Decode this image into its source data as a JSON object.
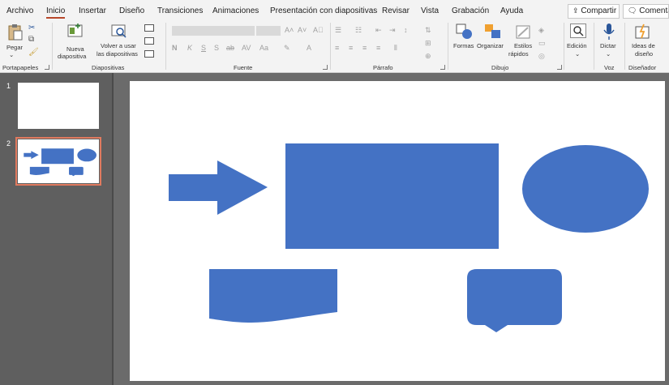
{
  "menu": {
    "tabs": [
      "Archivo",
      "Inicio",
      "Insertar",
      "Diseño",
      "Transiciones",
      "Animaciones",
      "Presentación con diapositivas",
      "Revisar",
      "Vista",
      "Grabación",
      "Ayuda"
    ],
    "share_label": "Compartir",
    "comments_label": "Comentar"
  },
  "ribbon": {
    "portapapeles": {
      "paste_label": "Pegar",
      "group_label": "Portapapeles"
    },
    "diapositivas": {
      "new_slide_line1": "Nueva",
      "new_slide_line2": "diapositiva",
      "reuse_line1": "Volver a usar",
      "reuse_line2": "las diapositivas",
      "group_label": "Diapositivas"
    },
    "fuente": {
      "group_label": "Fuente"
    },
    "parrafo": {
      "group_label": "Párrafo"
    },
    "dibujo": {
      "shapes_label": "Formas",
      "arrange_label": "Organizar",
      "quick_styles_line1": "Estilos",
      "quick_styles_line2": "rápidos",
      "group_label": "Dibujo"
    },
    "edicion": {
      "label": "Edición"
    },
    "voz": {
      "dictate_label": "Dictar",
      "group_label": "Voz"
    },
    "disenador": {
      "ideas_line1": "Ideas de",
      "ideas_line2": "diseño",
      "group_label": "Diseñador"
    }
  },
  "slides_panel": {
    "numbers": [
      "1",
      "2"
    ]
  },
  "colors": {
    "shape_fill": "#4472c4",
    "selection_outline": "#e07a5f",
    "active_tab_underline": "#b7472a"
  }
}
